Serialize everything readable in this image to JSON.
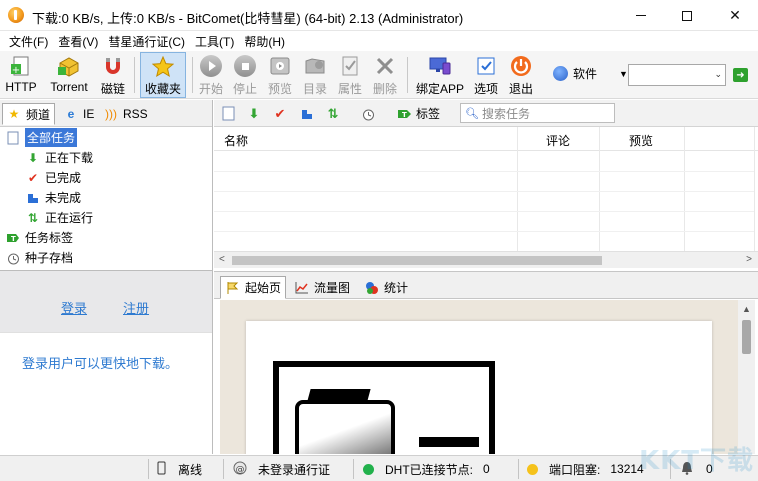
{
  "window": {
    "title": "下载:0 KB/s, 上传:0 KB/s - BitComet(比特彗星) (64-bit) 2.13 (Administrator)",
    "min_label": "",
    "close_label": "✕"
  },
  "menu": [
    "文件(F)",
    "查看(V)",
    "彗星通行证(C)",
    "工具(T)",
    "帮助(H)"
  ],
  "toolbar": {
    "http": "HTTP",
    "torrent": "Torrent",
    "magnet": "磁链",
    "favorites": "收藏夹",
    "start": "开始",
    "stop": "停止",
    "preview": "预览",
    "directory": "目录",
    "properties": "属性",
    "delete": "删除",
    "bind_app": "绑定APP",
    "options": "选项",
    "exit": "退出",
    "software": "软件",
    "url_value": "",
    "go_arrow": "➜"
  },
  "left_tabs": {
    "channel": "频道",
    "ie": "IE",
    "rss": "RSS"
  },
  "tree": {
    "all_tasks": "全部任务",
    "downloading": "正在下载",
    "completed": "已完成",
    "incomplete": "未完成",
    "running": "正在运行",
    "task_tags": "任务标签",
    "torrent_archive": "种子存档"
  },
  "login": {
    "login_link": "登录",
    "register_link": "注册",
    "message": "登录用户可以更快地下载。"
  },
  "task_tools": {
    "tags_label": "标签",
    "search_placeholder": "搜索任务"
  },
  "task_list": {
    "columns": [
      "名称",
      "评论",
      "预览"
    ]
  },
  "bottom_tabs": {
    "home": "起始页",
    "traffic": "流量图",
    "stats": "统计"
  },
  "status": {
    "offline": "离线",
    "pass_status": "未登录通行证",
    "dht_label": "DHT已连接节点:",
    "dht_nodes": "0",
    "port_label": "端口阻塞:",
    "port_value": "13214",
    "alerts": "0",
    "dht_color": "#22b14c",
    "port_color": "#f5c21b"
  },
  "watermark": "KKT下载"
}
